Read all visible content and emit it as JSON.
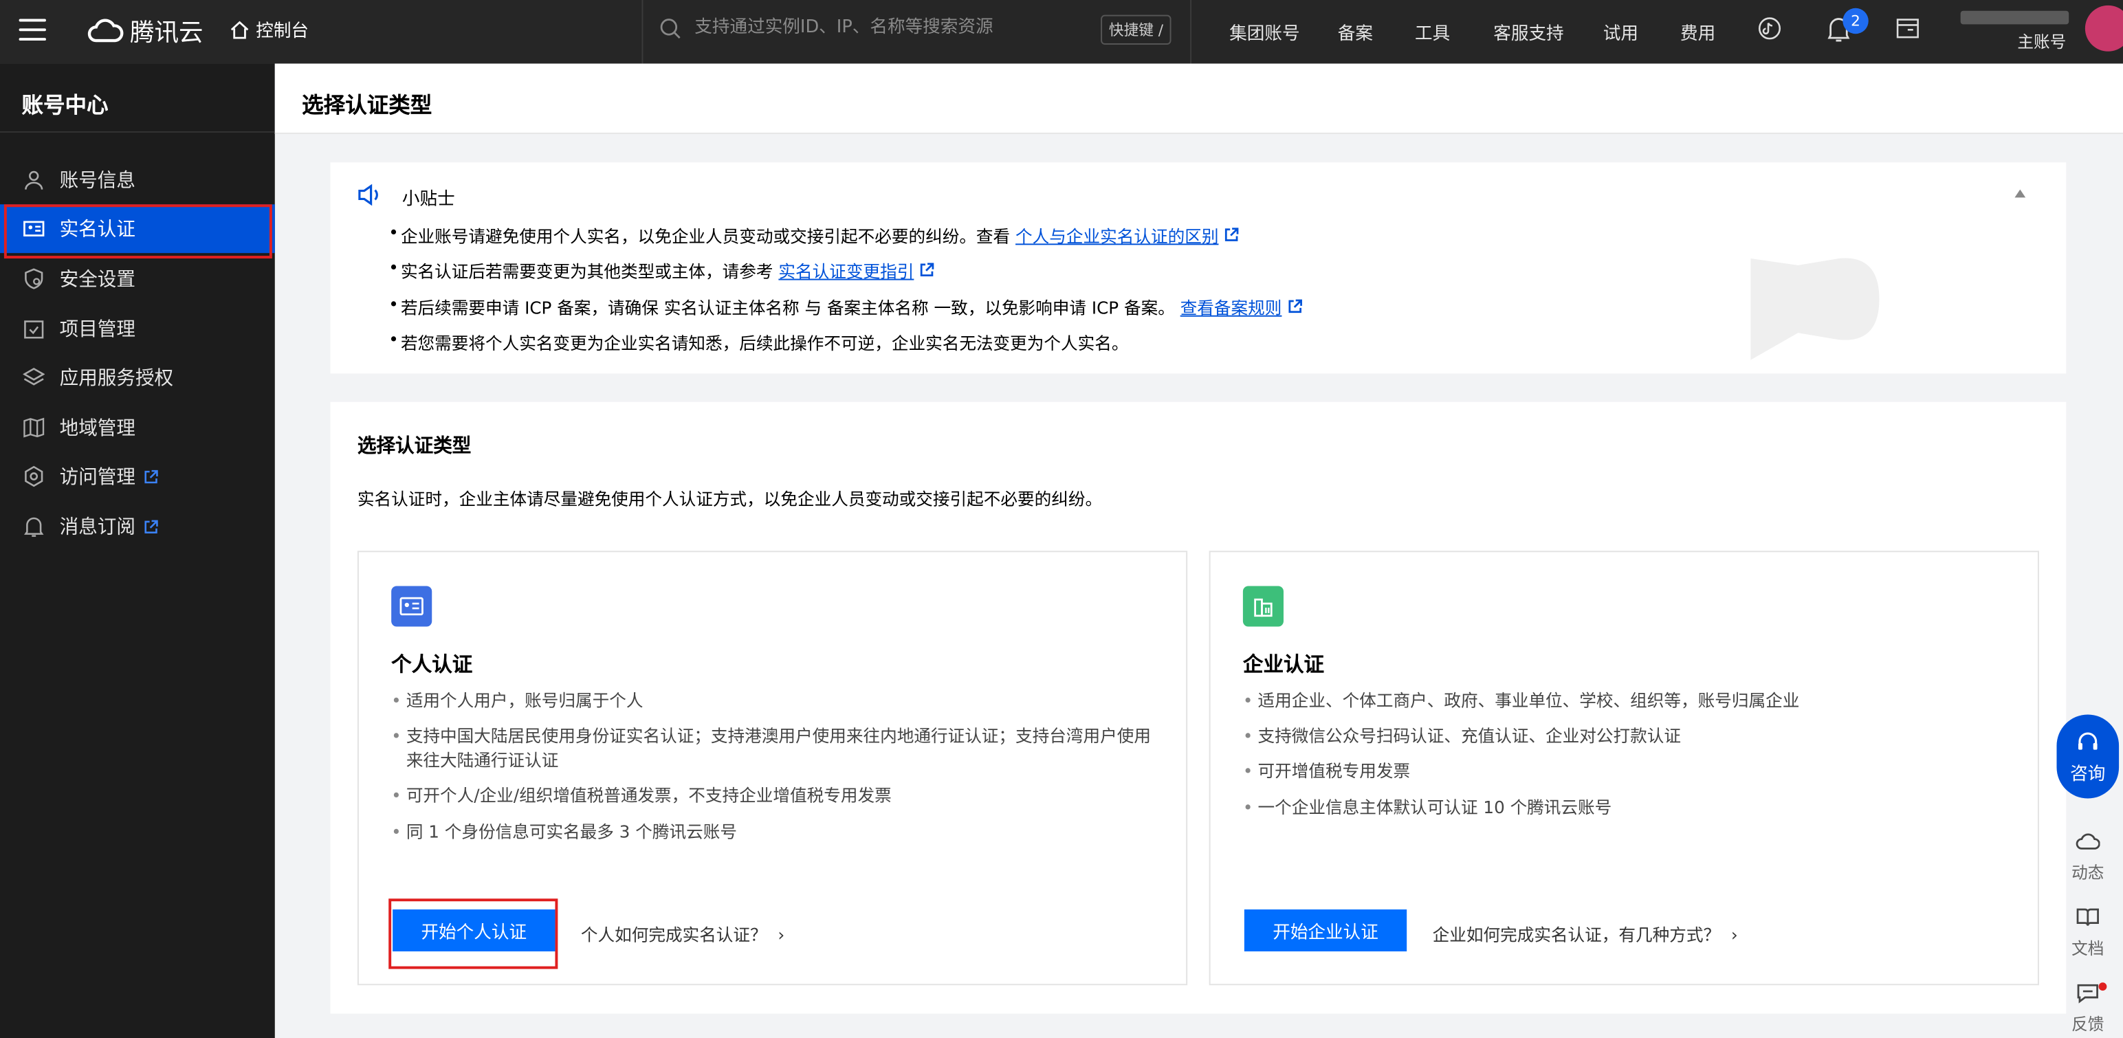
{
  "topbar": {
    "brand": "腾讯云",
    "console": "控制台",
    "search_placeholder": "支持通过实例ID、IP、名称等搜索资源",
    "shortcut": "快捷键 /",
    "nav": [
      "集团账号",
      "备案",
      "工具",
      "客服支持",
      "试用",
      "费用"
    ],
    "notification_count": "2",
    "account_label": "主账号"
  },
  "sidebar": {
    "title": "账号中心",
    "items": [
      {
        "label": "账号信息",
        "icon": "user-icon"
      },
      {
        "label": "实名认证",
        "icon": "id-card-icon",
        "active": true
      },
      {
        "label": "安全设置",
        "icon": "shield-icon"
      },
      {
        "label": "项目管理",
        "icon": "folder-icon"
      },
      {
        "label": "应用服务授权",
        "icon": "layers-icon"
      },
      {
        "label": "地域管理",
        "icon": "map-icon"
      },
      {
        "label": "访问管理",
        "icon": "gear-icon",
        "external": true
      },
      {
        "label": "消息订阅",
        "icon": "bell-icon",
        "external": true
      }
    ]
  },
  "page": {
    "title": "选择认证类型"
  },
  "tips": {
    "title": "小贴士",
    "line1_text": "企业账号请避免使用个人实名，以免企业人员变动或交接引起不必要的纠纷。查看",
    "line1_link": "个人与企业实名认证的区别",
    "line2_text": "实名认证后若需要变更为其他类型或主体，请参考",
    "line2_link": "实名认证变更指引",
    "line3_text": "若后续需要申请 ICP 备案，请确保 实名认证主体名称 与 备案主体名称 一致，以免影响申请 ICP 备案。",
    "line3_link": "查看备案规则",
    "line4_text": "若您需要将个人实名变更为企业实名请知悉，后续此操作不可逆，企业实名无法变更为个人实名。"
  },
  "section": {
    "title": "选择认证类型",
    "desc": "实名认证时，企业主体请尽量避免使用个人认证方式，以免企业人员变动或交接引起不必要的纠纷。"
  },
  "personal": {
    "title": "个人认证",
    "features": [
      "适用个人用户，账号归属于个人",
      "支持中国大陆居民使用身份证实名认证；支持港澳用户使用来往内地通行证认证；支持台湾用户使用来往大陆通行证认证",
      "可开个人/企业/组织增值税普通发票，不支持企业增值税专用发票",
      "同 1 个身份信息可实名最多 3 个腾讯云账号"
    ],
    "button": "开始个人认证",
    "help": "个人如何完成实名认证？"
  },
  "enterprise": {
    "title": "企业认证",
    "features": [
      "适用企业、个体工商户、政府、事业单位、学校、组织等，账号归属企业",
      "支持微信公众号扫码认证、充值认证、企业对公打款认证",
      "可开增值税专用发票",
      "一个企业信息主体默认可认证 10 个腾讯云账号"
    ],
    "button": "开始企业认证",
    "help": "企业如何完成实名认证，有几种方式？"
  },
  "floating": {
    "consult": "咨询",
    "tools": [
      "动态",
      "文档",
      "反馈"
    ]
  },
  "colors": {
    "accent": "#0052d9",
    "button": "#006eff",
    "highlight": "#e02020"
  }
}
